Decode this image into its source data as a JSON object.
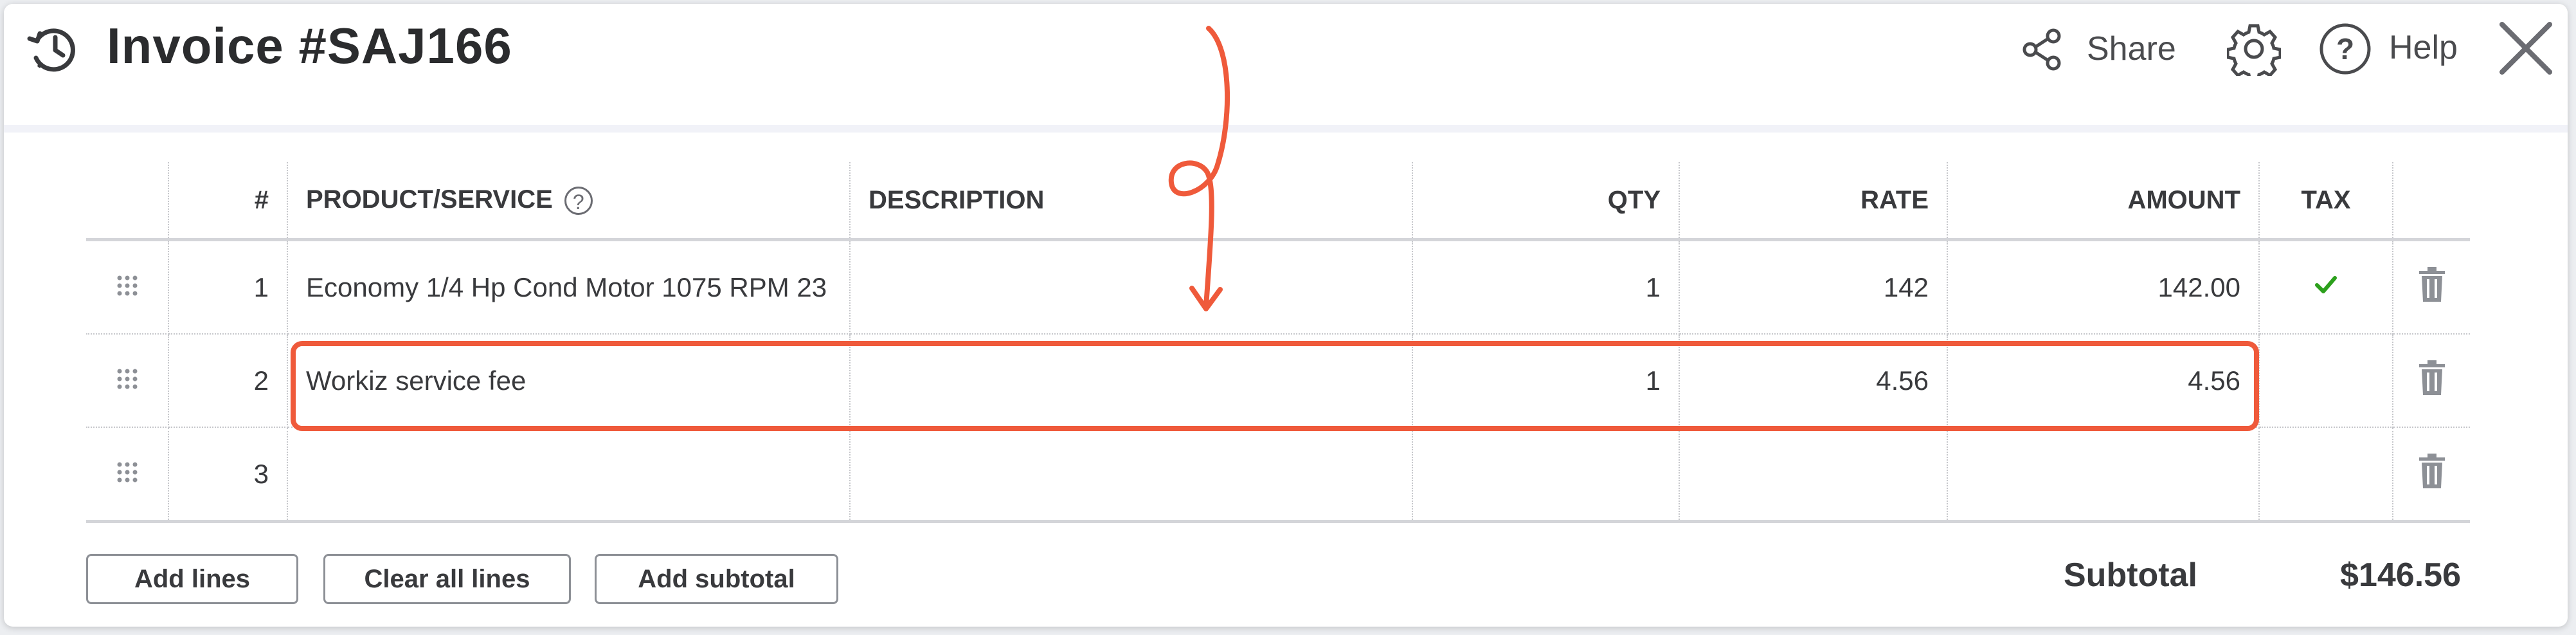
{
  "header": {
    "title": "Invoice #SAJ166",
    "share_label": "Share",
    "help_label": "Help",
    "help_glyph": "?"
  },
  "table": {
    "columns": {
      "num": "#",
      "product": "PRODUCT/SERVICE",
      "description": "DESCRIPTION",
      "qty": "QTY",
      "rate": "RATE",
      "amount": "AMOUNT",
      "tax": "TAX"
    },
    "rows": [
      {
        "num": "1",
        "product": "Economy 1/4 Hp Cond Motor 1075 RPM 23",
        "description": "",
        "qty": "1",
        "rate": "142",
        "amount": "142.00",
        "taxable": true
      },
      {
        "num": "2",
        "product": "Workiz service fee",
        "description": "",
        "qty": "1",
        "rate": "4.56",
        "amount": "4.56",
        "taxable": false
      },
      {
        "num": "3",
        "product": "",
        "description": "",
        "qty": "",
        "rate": "",
        "amount": "",
        "taxable": false
      }
    ]
  },
  "footer": {
    "add_lines": "Add lines",
    "clear_all_lines": "Clear all lines",
    "add_subtotal": "Add subtotal",
    "subtotal_label": "Subtotal",
    "subtotal_value": "$146.56"
  },
  "colors": {
    "annotation": "#ef5a3b",
    "check": "#2ca01c"
  },
  "icons": [
    "history-icon",
    "share-icon",
    "gear-icon",
    "help-icon",
    "close-icon",
    "drag-handle-icon",
    "trash-icon",
    "check-icon",
    "arrow-annotation"
  ]
}
